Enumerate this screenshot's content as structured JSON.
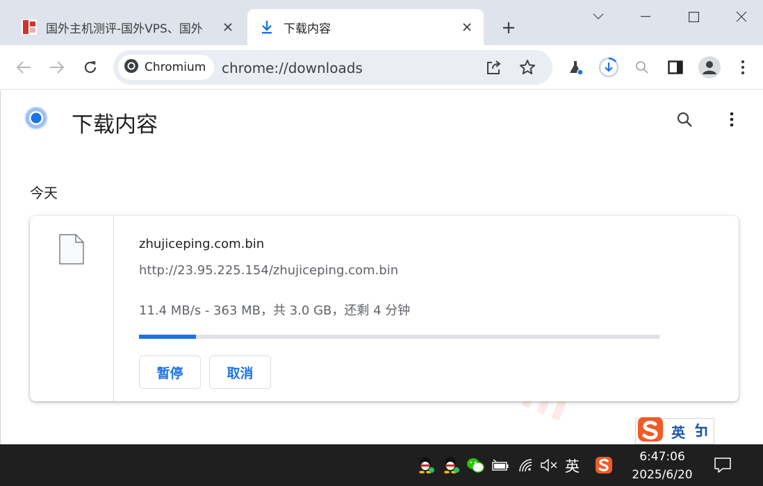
{
  "tabs": [
    {
      "title": "国外主机测评-国外VPS、国外",
      "active": false
    },
    {
      "title": "下载内容",
      "active": true
    }
  ],
  "toolbar": {
    "site_chip": "Chromium",
    "url": "chrome://downloads"
  },
  "page": {
    "title": "下载内容",
    "section_date": "今天",
    "watermark": "zhujiceping.com"
  },
  "download": {
    "file_name": "zhujiceping.com.bin",
    "url": "http://23.95.225.154/zhujiceping.com.bin",
    "status": "11.4 MB/s - 363 MB，共 3.0 GB，还剩 4 分钟",
    "progress_fraction": 0.11,
    "pause_label": "暂停",
    "cancel_label": "取消"
  },
  "ime": {
    "lang_label": "英"
  },
  "taskbar": {
    "ime_lang": "英",
    "time": "6:47:06",
    "date": "2025/6/20"
  },
  "colors": {
    "accent": "#1a73e8",
    "tabstrip": "#dfe3eb",
    "taskbar": "#1f1f1f"
  }
}
